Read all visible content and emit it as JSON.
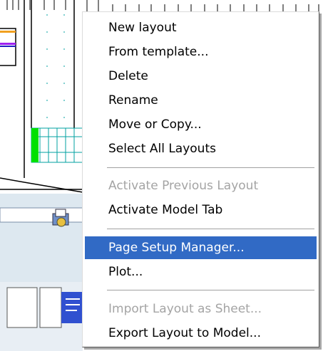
{
  "context_menu": {
    "groups": [
      [
        {
          "label": "New layout",
          "enabled": true
        },
        {
          "label": "From template...",
          "enabled": true
        },
        {
          "label": "Delete",
          "enabled": true
        },
        {
          "label": "Rename",
          "enabled": true
        },
        {
          "label": "Move or Copy...",
          "enabled": true
        },
        {
          "label": "Select All Layouts",
          "enabled": true
        }
      ],
      [
        {
          "label": "Activate Previous Layout",
          "enabled": false
        },
        {
          "label": "Activate Model Tab",
          "enabled": true
        }
      ],
      [
        {
          "label": "Page Setup Manager...",
          "enabled": true,
          "highlighted": true
        },
        {
          "label": "Plot...",
          "enabled": true
        }
      ],
      [
        {
          "label": "Import Layout as Sheet...",
          "enabled": false
        },
        {
          "label": "Export Layout to Model...",
          "enabled": true
        }
      ]
    ],
    "highlight_color": "#316ac5",
    "disabled_color": "#a4a4a4"
  },
  "background": {
    "accent_green": "#00e000",
    "accent_teal": "#00a0a0",
    "panel_color": "#dde8f0",
    "icon": "plot-stamp-icon"
  }
}
